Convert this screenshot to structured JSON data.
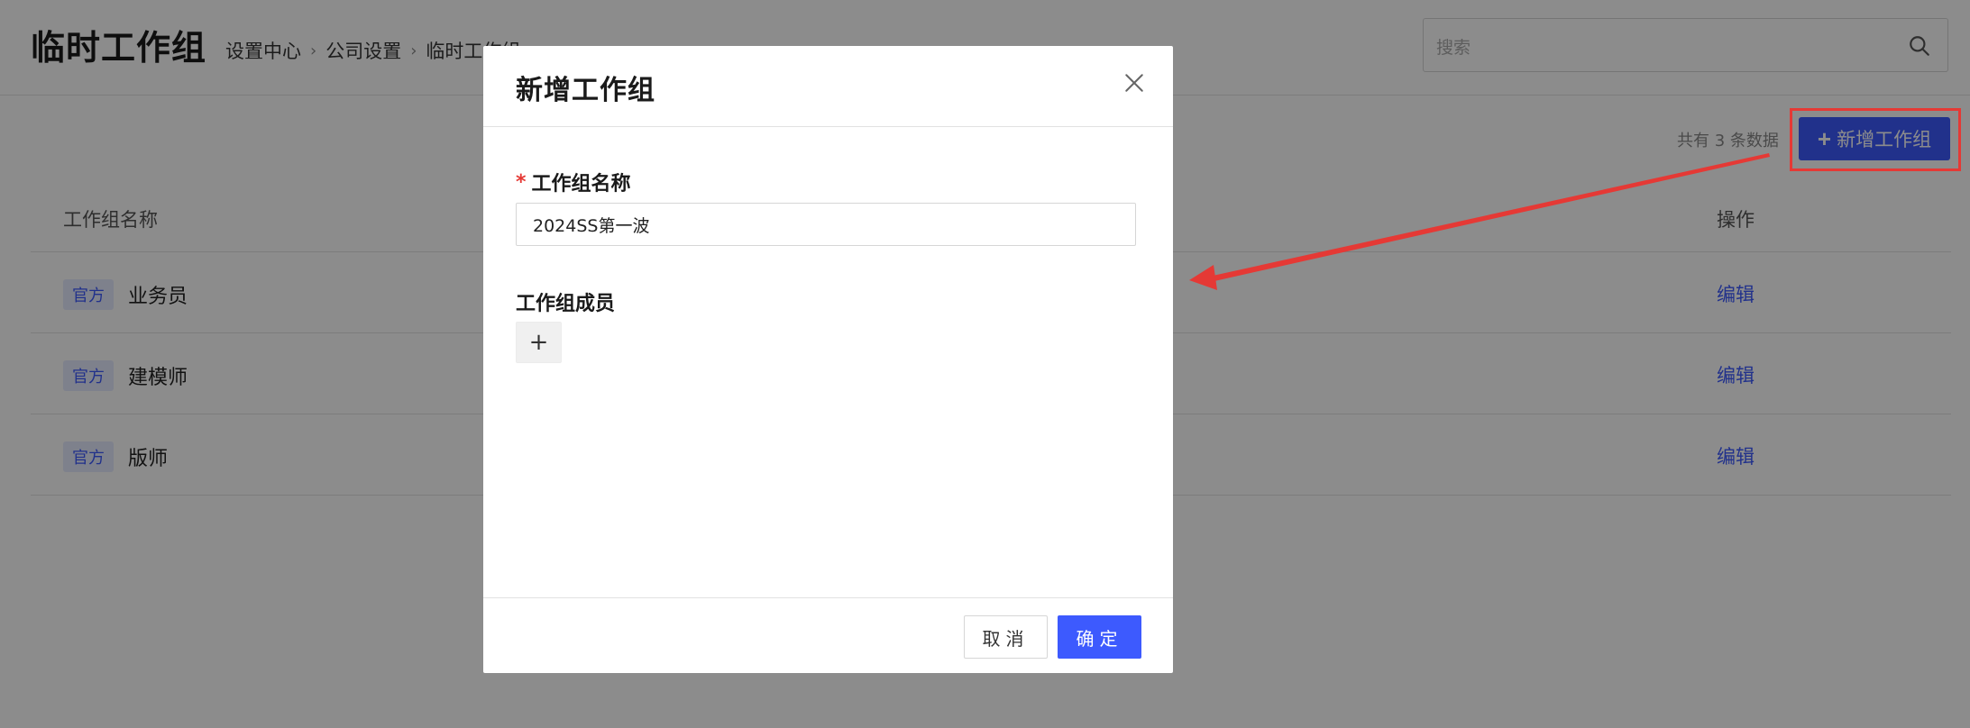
{
  "header": {
    "page_title": "临时工作组",
    "breadcrumb": [
      "设置中心",
      "公司设置",
      "临时工作组"
    ],
    "search_placeholder": "搜索"
  },
  "toolbar": {
    "count_text": "共有 3 条数据",
    "add_button_label": "新增工作组"
  },
  "table": {
    "col_name": "工作组名称",
    "col_action": "操作",
    "rows": [
      {
        "tag": "官方",
        "name": "业务员",
        "action": "编辑"
      },
      {
        "tag": "官方",
        "name": "建模师",
        "action": "编辑"
      },
      {
        "tag": "官方",
        "name": "版师",
        "action": "编辑"
      }
    ]
  },
  "modal": {
    "title": "新增工作组",
    "name_label": "工作组名称",
    "name_value": "2024SS第一波",
    "members_label": "工作组成员",
    "add_member_symbol": "+",
    "cancel_label": "取消",
    "ok_label": "确定"
  },
  "colors": {
    "accent": "#3d5afe",
    "annotation": "#e53935",
    "tag_bg": "#e6ecff"
  }
}
